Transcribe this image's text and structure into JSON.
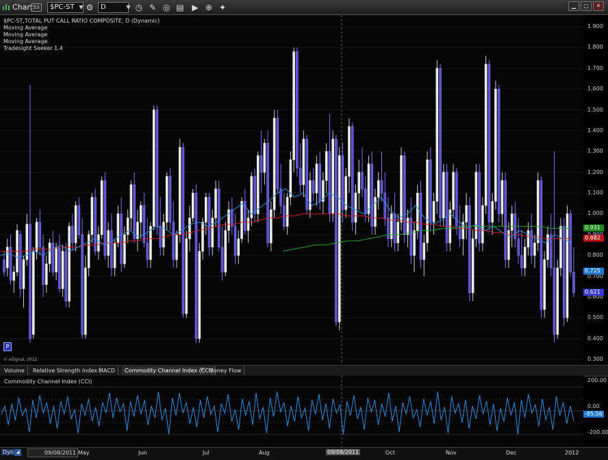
{
  "titlebar": {
    "title": "Chart",
    "badge": "53",
    "symbol": "$PC-ST",
    "interval": "D",
    "colors": {
      "accent": "#2a36ad"
    }
  },
  "legend": {
    "lines": [
      "$PC-ST,TOTAL PUT CALL RATIO COMPOSITE, D (Dynamic)",
      "Moving Average",
      "Moving Average",
      "Moving Average",
      "Tradesight Seeker 1.4"
    ]
  },
  "price_axis": {
    "ticks": [
      "1.900",
      "1.800",
      "1.700",
      "1.600",
      "1.500",
      "1.400",
      "1.300",
      "1.200",
      "1.100",
      "1.000",
      "0.900",
      "0.800",
      "0.700",
      "0.600",
      "0.500",
      "0.400",
      "0.300"
    ],
    "tags": [
      {
        "label": "0.931",
        "color": "#1a8a1a"
      },
      {
        "label": "0.882",
        "color": "#c01818"
      },
      {
        "label": "0.725",
        "color": "#1f7ad6"
      },
      {
        "label": "0.621",
        "color": "#3a3ad8"
      }
    ]
  },
  "copyright": "© eSignal, 2012",
  "p_marker": "P",
  "tabs": [
    {
      "label": "Volume"
    },
    {
      "label": "Relative Strength Index"
    },
    {
      "label": "MACD"
    },
    {
      "label": "Commodity Channel Index (CCI)"
    },
    {
      "label": "Money Flow"
    }
  ],
  "cci_panel": {
    "title": "Commodity Channel Index (CCI)",
    "ticks": [
      "200.00",
      "0.00",
      "-200.00"
    ],
    "tag": "-85.56"
  },
  "xaxis": {
    "dyn": "Dyn",
    "date_box": "09/08/2011",
    "cursor_date": "09/08/2011",
    "labels": [
      "May",
      "Jun",
      "Jul",
      "Aug",
      "Oct",
      "Nov",
      "Dec",
      "2012"
    ]
  },
  "chart_data": {
    "type": "candlestick",
    "ylim": [
      0.3,
      1.9
    ],
    "candles": [
      [
        0.78,
        0.82,
        0.7,
        0.72
      ],
      [
        0.74,
        0.88,
        0.7,
        0.84
      ],
      [
        0.84,
        0.9,
        0.66,
        0.68
      ],
      [
        0.68,
        0.75,
        0.62,
        0.72
      ],
      [
        0.72,
        0.95,
        0.7,
        0.92
      ],
      [
        0.9,
        0.92,
        0.6,
        0.64
      ],
      [
        0.64,
        0.8,
        0.55,
        0.78
      ],
      [
        0.78,
        1.0,
        0.75,
        0.95
      ],
      [
        0.95,
        1.62,
        0.38,
        0.4
      ],
      [
        0.42,
        0.84,
        0.4,
        0.82
      ],
      [
        0.82,
        0.98,
        0.78,
        0.96
      ],
      [
        0.96,
        1.02,
        0.8,
        0.84
      ],
      [
        0.84,
        0.9,
        0.6,
        0.66
      ],
      [
        0.66,
        0.8,
        0.62,
        0.76
      ],
      [
        0.76,
        0.88,
        0.72,
        0.86
      ],
      [
        0.86,
        0.92,
        0.7,
        0.72
      ],
      [
        0.72,
        0.86,
        0.68,
        0.84
      ],
      [
        0.84,
        0.9,
        0.62,
        0.64
      ],
      [
        0.64,
        0.85,
        0.6,
        0.82
      ],
      [
        0.82,
        0.86,
        0.55,
        0.58
      ],
      [
        0.58,
        0.96,
        0.55,
        0.94
      ],
      [
        0.94,
        1.0,
        0.82,
        0.86
      ],
      [
        0.86,
        1.06,
        0.82,
        1.04
      ],
      [
        1.04,
        1.08,
        0.88,
        0.9
      ],
      [
        0.9,
        0.98,
        0.4,
        0.42
      ],
      [
        0.42,
        0.8,
        0.4,
        0.74
      ],
      [
        0.74,
        0.92,
        0.7,
        0.9
      ],
      [
        0.9,
        1.1,
        0.86,
        1.08
      ],
      [
        1.08,
        1.12,
        0.8,
        0.82
      ],
      [
        0.82,
        0.94,
        0.78,
        0.9
      ],
      [
        0.9,
        1.18,
        0.88,
        1.16
      ],
      [
        1.16,
        1.2,
        0.78,
        0.8
      ],
      [
        0.8,
        0.96,
        0.74,
        0.92
      ],
      [
        0.92,
        1.0,
        0.7,
        0.74
      ],
      [
        0.74,
        0.88,
        0.7,
        0.86
      ],
      [
        0.86,
        1.04,
        0.84,
        1.0
      ],
      [
        1.0,
        1.08,
        0.72,
        0.76
      ],
      [
        0.76,
        0.94,
        0.74,
        0.9
      ],
      [
        0.9,
        1.02,
        0.86,
        0.98
      ],
      [
        0.98,
        1.16,
        0.92,
        1.14
      ],
      [
        1.14,
        1.2,
        0.86,
        0.88
      ],
      [
        0.88,
        1.02,
        0.82,
        0.96
      ],
      [
        0.96,
        1.06,
        0.88,
        1.04
      ],
      [
        1.04,
        1.1,
        0.84,
        0.86
      ],
      [
        0.86,
        0.98,
        0.74,
        0.78
      ],
      [
        0.78,
        0.96,
        0.74,
        0.94
      ],
      [
        0.94,
        1.52,
        0.92,
        1.5
      ],
      [
        1.5,
        1.52,
        0.9,
        0.94
      ],
      [
        0.94,
        1.08,
        0.8,
        0.84
      ],
      [
        0.84,
        1.0,
        0.8,
        0.96
      ],
      [
        0.96,
        1.2,
        0.92,
        1.18
      ],
      [
        1.18,
        1.22,
        0.92,
        0.96
      ],
      [
        0.96,
        1.06,
        0.74,
        0.78
      ],
      [
        0.78,
        0.92,
        0.74,
        0.9
      ],
      [
        0.9,
        1.36,
        0.86,
        1.32
      ],
      [
        1.32,
        1.34,
        0.5,
        0.52
      ],
      [
        0.52,
        0.92,
        0.5,
        0.88
      ],
      [
        0.88,
        1.04,
        0.82,
        0.98
      ],
      [
        0.98,
        1.12,
        0.96,
        1.1
      ],
      [
        1.1,
        1.14,
        0.38,
        0.4
      ],
      [
        0.4,
        0.86,
        0.38,
        0.82
      ],
      [
        0.82,
        0.98,
        0.78,
        0.96
      ],
      [
        0.96,
        1.1,
        0.9,
        1.08
      ],
      [
        1.08,
        1.1,
        0.8,
        0.84
      ],
      [
        0.84,
        1.02,
        0.8,
        0.98
      ],
      [
        0.98,
        1.16,
        0.94,
        1.12
      ],
      [
        1.12,
        1.16,
        0.82,
        0.84
      ],
      [
        0.84,
        0.94,
        0.68,
        0.72
      ],
      [
        0.72,
        0.96,
        0.7,
        0.92
      ],
      [
        0.92,
        1.06,
        0.86,
        1.02
      ],
      [
        1.02,
        1.08,
        0.9,
        0.94
      ],
      [
        0.94,
        1.0,
        0.76,
        0.8
      ],
      [
        0.8,
        0.92,
        0.76,
        0.88
      ],
      [
        0.88,
        1.08,
        0.86,
        1.06
      ],
      [
        1.06,
        1.12,
        0.9,
        0.92
      ],
      [
        0.92,
        1.02,
        0.86,
        0.98
      ],
      [
        0.98,
        1.2,
        0.94,
        1.18
      ],
      [
        1.18,
        1.22,
        0.96,
        1.0
      ],
      [
        1.0,
        1.3,
        0.96,
        1.28
      ],
      [
        1.28,
        1.4,
        1.1,
        1.2
      ],
      [
        1.2,
        1.36,
        1.14,
        1.34
      ],
      [
        1.34,
        1.4,
        0.84,
        0.86
      ],
      [
        0.86,
        1.06,
        0.82,
        1.02
      ],
      [
        1.02,
        1.5,
        0.98,
        1.46
      ],
      [
        1.46,
        1.5,
        1.1,
        1.12
      ],
      [
        1.12,
        1.24,
        1.0,
        1.04
      ],
      [
        1.04,
        1.1,
        0.92,
        0.94
      ],
      [
        0.94,
        1.1,
        0.9,
        1.08
      ],
      [
        1.08,
        1.3,
        1.04,
        1.26
      ],
      [
        1.26,
        1.8,
        1.2,
        1.78
      ],
      [
        1.78,
        1.8,
        1.18,
        1.22
      ],
      [
        1.22,
        1.34,
        1.1,
        1.14
      ],
      [
        1.14,
        1.4,
        1.08,
        1.36
      ],
      [
        1.36,
        1.38,
        1.0,
        1.02
      ],
      [
        1.02,
        1.2,
        0.98,
        1.16
      ],
      [
        1.16,
        1.22,
        1.06,
        1.1
      ],
      [
        1.1,
        1.28,
        1.04,
        1.24
      ],
      [
        1.24,
        1.3,
        1.02,
        1.06
      ],
      [
        1.06,
        1.2,
        1.0,
        1.16
      ],
      [
        1.16,
        1.34,
        1.1,
        1.3
      ],
      [
        1.3,
        1.48,
        0.96,
        1.0
      ],
      [
        1.0,
        1.4,
        0.96,
        1.36
      ],
      [
        1.36,
        1.38,
        0.46,
        0.48
      ],
      [
        0.48,
        1.32,
        0.44,
        1.28
      ],
      [
        1.28,
        1.34,
        0.96,
        1.02
      ],
      [
        1.02,
        1.22,
        0.98,
        1.18
      ],
      [
        1.18,
        1.46,
        1.1,
        1.42
      ],
      [
        1.42,
        1.44,
        0.92,
        0.96
      ],
      [
        0.96,
        1.14,
        0.9,
        1.1
      ],
      [
        1.1,
        1.26,
        1.02,
        1.2
      ],
      [
        1.2,
        1.32,
        1.08,
        1.12
      ],
      [
        1.12,
        1.18,
        0.96,
        1.0
      ],
      [
        1.0,
        1.28,
        0.96,
        1.24
      ],
      [
        1.24,
        1.3,
        0.9,
        0.94
      ],
      [
        0.94,
        1.12,
        0.9,
        1.08
      ],
      [
        1.08,
        1.2,
        1.02,
        1.16
      ],
      [
        1.16,
        1.3,
        1.06,
        1.1
      ],
      [
        1.1,
        1.2,
        0.94,
        0.98
      ],
      [
        0.98,
        1.08,
        0.84,
        0.88
      ],
      [
        0.88,
        1.04,
        0.84,
        1.0
      ],
      [
        1.0,
        1.1,
        0.82,
        0.86
      ],
      [
        0.86,
        1.0,
        0.82,
        0.96
      ],
      [
        0.96,
        1.32,
        0.92,
        1.28
      ],
      [
        1.28,
        1.3,
        0.86,
        0.9
      ],
      [
        0.9,
        1.02,
        0.84,
        0.98
      ],
      [
        0.98,
        1.08,
        0.76,
        0.8
      ],
      [
        0.8,
        0.96,
        0.72,
        0.92
      ],
      [
        0.92,
        1.14,
        0.88,
        1.1
      ],
      [
        1.1,
        1.16,
        0.74,
        0.78
      ],
      [
        0.78,
        0.9,
        0.7,
        0.86
      ],
      [
        0.86,
        1.3,
        0.82,
        1.26
      ],
      [
        1.26,
        1.32,
        0.92,
        0.96
      ],
      [
        0.96,
        1.1,
        0.9,
        1.06
      ],
      [
        1.06,
        1.74,
        1.0,
        1.7
      ],
      [
        1.7,
        1.72,
        0.94,
        0.98
      ],
      [
        0.98,
        1.24,
        0.94,
        1.2
      ],
      [
        1.2,
        1.24,
        0.82,
        0.86
      ],
      [
        0.86,
        1.06,
        0.82,
        1.02
      ],
      [
        1.02,
        1.24,
        0.98,
        1.2
      ],
      [
        1.2,
        1.22,
        0.9,
        0.94
      ],
      [
        0.94,
        1.04,
        0.84,
        0.88
      ],
      [
        0.88,
        1.0,
        0.8,
        0.96
      ],
      [
        0.96,
        1.1,
        0.88,
        1.04
      ],
      [
        1.04,
        1.08,
        0.58,
        0.62
      ],
      [
        0.62,
        0.92,
        0.58,
        0.88
      ],
      [
        0.88,
        1.24,
        0.84,
        1.2
      ],
      [
        1.2,
        1.24,
        0.82,
        0.86
      ],
      [
        0.86,
        1.08,
        0.82,
        1.04
      ],
      [
        1.04,
        1.76,
        1.0,
        1.72
      ],
      [
        1.72,
        1.74,
        0.92,
        0.96
      ],
      [
        0.96,
        1.1,
        0.9,
        1.06
      ],
      [
        1.06,
        1.64,
        1.02,
        1.6
      ],
      [
        1.6,
        1.62,
        0.96,
        1.0
      ],
      [
        1.0,
        1.2,
        0.94,
        1.16
      ],
      [
        1.16,
        1.2,
        0.74,
        0.78
      ],
      [
        0.78,
        0.96,
        0.74,
        0.92
      ],
      [
        0.92,
        1.04,
        0.84,
        1.0
      ],
      [
        1.0,
        1.06,
        0.84,
        0.88
      ],
      [
        0.88,
        0.98,
        0.76,
        0.8
      ],
      [
        0.8,
        0.92,
        0.7,
        0.74
      ],
      [
        0.74,
        0.88,
        0.7,
        0.84
      ],
      [
        0.84,
        0.96,
        0.8,
        0.92
      ],
      [
        0.92,
        1.0,
        0.76,
        0.8
      ],
      [
        0.8,
        0.9,
        0.74,
        0.86
      ],
      [
        0.86,
        1.2,
        0.82,
        1.16
      ],
      [
        1.16,
        1.18,
        0.5,
        0.54
      ],
      [
        0.54,
        0.82,
        0.5,
        0.78
      ],
      [
        0.78,
        0.94,
        0.74,
        0.9
      ],
      [
        0.9,
        1.0,
        0.7,
        0.74
      ],
      [
        0.74,
        1.3,
        0.38,
        0.42
      ],
      [
        0.42,
        0.78,
        0.4,
        0.74
      ],
      [
        0.74,
        0.98,
        0.7,
        0.94
      ],
      [
        0.94,
        0.98,
        0.46,
        0.5
      ],
      [
        0.5,
        1.04,
        0.48,
        1.0
      ],
      [
        1.0,
        1.02,
        0.7,
        0.72
      ],
      [
        0.72,
        0.84,
        0.6,
        0.62
      ]
    ],
    "ma_blue": [
      0.8,
      0.81,
      0.79,
      0.8,
      0.82,
      0.8,
      0.83,
      0.85,
      0.82,
      0.84,
      0.86,
      0.88,
      0.85,
      0.87,
      0.9,
      0.92,
      0.89,
      0.91,
      0.94,
      0.93,
      0.9,
      0.92,
      0.95,
      0.96,
      0.94,
      0.96,
      0.99,
      1.02,
      1.05,
      1.0,
      1.03,
      1.06,
      1.1,
      1.12,
      1.08,
      1.1,
      1.04,
      1.06,
      1.1,
      1.08,
      1.04,
      1.02,
      1.0,
      1.04,
      1.08,
      1.02,
      0.98,
      1.0,
      1.04,
      0.98,
      0.95,
      0.97,
      1.0,
      0.96,
      0.93,
      0.95,
      0.92,
      0.94,
      0.91,
      0.89,
      0.92,
      0.9,
      0.88,
      0.86,
      0.9,
      0.88,
      0.86
    ],
    "ma_red": [
      0.82,
      0.82,
      0.82,
      0.82,
      0.83,
      0.83,
      0.83,
      0.84,
      0.84,
      0.84,
      0.85,
      0.85,
      0.86,
      0.86,
      0.86,
      0.87,
      0.87,
      0.88,
      0.88,
      0.89,
      0.9,
      0.9,
      0.91,
      0.92,
      0.93,
      0.94,
      0.95,
      0.95,
      0.96,
      0.96,
      0.97,
      0.98,
      0.98,
      0.99,
      0.99,
      1.0,
      1.0,
      1.0,
      1.0,
      1.0,
      0.99,
      0.99,
      0.99,
      0.98,
      0.98,
      0.97,
      0.97,
      0.96,
      0.96,
      0.95,
      0.95,
      0.94,
      0.94,
      0.93,
      0.93,
      0.92,
      0.92,
      0.91,
      0.91,
      0.9,
      0.9,
      0.89,
      0.89,
      0.88,
      0.88,
      0.88,
      0.88
    ],
    "ma_green": [
      0.82,
      0.83,
      0.84,
      0.85,
      0.85,
      0.86,
      0.87,
      0.87,
      0.88,
      0.89,
      0.9,
      0.9,
      0.91,
      0.92,
      0.92,
      0.93,
      0.93,
      0.94,
      0.94,
      0.94,
      0.94,
      0.94,
      0.94,
      0.94,
      0.94,
      0.93,
      0.93,
      0.93
    ],
    "cci": [
      -30,
      40,
      -120,
      60,
      -80,
      110,
      -40,
      20,
      -180,
      90,
      -60,
      130,
      -20,
      70,
      -110,
      40,
      -150,
      80,
      -30,
      120,
      -70,
      10,
      -190,
      60,
      -40,
      100,
      -90,
      30,
      -130,
      70,
      -20,
      150,
      -60,
      110,
      -10,
      60,
      -170,
      80,
      -50,
      130,
      -30,
      90,
      -120,
      40,
      -60,
      160,
      -80,
      20,
      -200,
      110,
      -40,
      150,
      -20,
      70,
      -110,
      30,
      -140,
      90,
      -60,
      120,
      -30,
      40,
      -180,
      60,
      -20,
      140,
      -90,
      10,
      -160,
      100,
      -40,
      80,
      -120,
      150,
      -70,
      30,
      -190,
      110,
      -50,
      160,
      -10,
      70,
      -130,
      40,
      -90,
      120,
      -60,
      20,
      -170,
      90,
      -30,
      140,
      -80,
      60,
      -150,
      100,
      -20,
      50,
      -200,
      80,
      -40,
      130,
      -70,
      30,
      -160,
      110,
      -10,
      90,
      -120,
      60,
      -50,
      150,
      -90,
      40,
      -180,
      70,
      -30,
      120,
      -60,
      10,
      -140,
      100,
      -40,
      80,
      -110,
      160,
      -80,
      30,
      -190,
      120,
      -20,
      60,
      -100,
      90,
      -150,
      40,
      -70,
      130,
      -30,
      80,
      -120,
      60,
      -170,
      20,
      -90,
      110,
      -40,
      70,
      -200,
      90,
      -60,
      140,
      -20,
      50,
      -130,
      100,
      -80,
      30,
      -160,
      120,
      -40,
      70,
      -110,
      40,
      -86
    ]
  }
}
